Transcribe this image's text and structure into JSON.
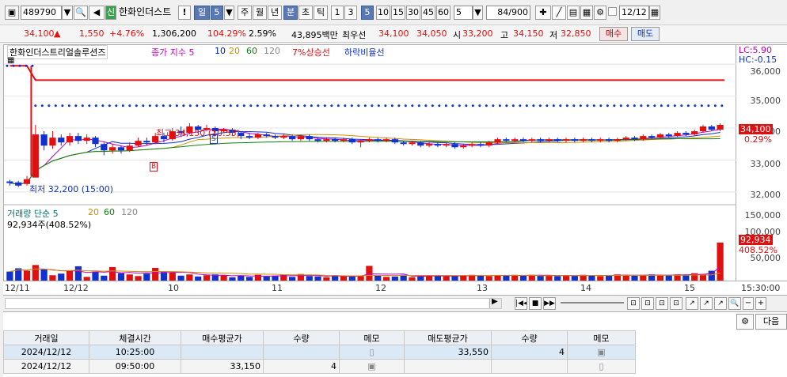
{
  "toolbar": {
    "code": "489790",
    "stock_badge": "신",
    "stock_name": "한화인더스트",
    "periods": [
      "일",
      "5",
      "주",
      "월",
      "년",
      "분",
      "초",
      "틱"
    ],
    "minutes": [
      "1",
      "3",
      "5",
      "10",
      "15",
      "30",
      "45",
      "60"
    ],
    "interval_value": "5",
    "count_display": "84/900",
    "date": "12/12"
  },
  "quote": {
    "price": "34,100",
    "arrow": "▲",
    "change": "1,550",
    "change_pct": "+4.76%",
    "volume": "1,306,200",
    "vol_ratio": "104.29%",
    "turnover": "2.59%",
    "amount": "43,895백만",
    "best_label": "최우선",
    "ask": "34,100",
    "bid": "34,050",
    "open_label": "시",
    "open": "33,200",
    "high_label": "고",
    "high": "34,150",
    "low_label": "저",
    "low": "32,850",
    "buy_btn": "매수",
    "sell_btn": "매도"
  },
  "chart": {
    "title": "한화인더스트리얼솔루션즈",
    "price_legend": "종가 지수 5",
    "ma_labels": [
      "10",
      "20",
      "60",
      "120"
    ],
    "ma_colors": [
      "#ff7700",
      "#c8a000",
      "#108010",
      "#a0a0a0"
    ],
    "upper_limit_label": "7%상승선",
    "lower_limit_label": "하락비율선",
    "lc_label": "LC:5.90",
    "hc_label": "HC:-0.15",
    "price_ticks": [
      "36,000",
      "35,000",
      "34,000",
      "33,000",
      "32,000"
    ],
    "current_price_tag": "34,100",
    "current_pct_tag": "0.29%",
    "high_annot": "최고 34,150 (10:55)",
    "low_annot": "최저 32,200 (15:00)",
    "marker_s": "S",
    "marker_b": "B",
    "volume_legend": "거래량 단순 5",
    "volume_ma": [
      "20",
      "60",
      "120"
    ],
    "volume_value": "92,934주(408.52%)",
    "volume_ticks": [
      "150,000",
      "100,000",
      "50,000"
    ],
    "volume_tag": "92,934",
    "volume_pct_tag": "408.52%",
    "time_labels": [
      "12/11",
      "12/12",
      "10",
      "11",
      "12",
      "13",
      "14",
      "15"
    ],
    "time_end": "15:30:00"
  },
  "chart_data": {
    "type": "candlestick",
    "ylim": [
      31700,
      36400
    ],
    "candles": [
      {
        "o": 32330,
        "c": 32280,
        "h": 32380,
        "l": 32200
      },
      {
        "o": 32300,
        "c": 32200,
        "h": 32350,
        "l": 32150
      },
      {
        "o": 32250,
        "c": 32400,
        "h": 32500,
        "l": 32200
      },
      {
        "o": 32450,
        "c": 33800,
        "h": 34100,
        "l": 32850
      },
      {
        "o": 33800,
        "c": 33450,
        "h": 33900,
        "l": 33300
      },
      {
        "o": 33450,
        "c": 33700,
        "h": 33900,
        "l": 33350
      },
      {
        "o": 33700,
        "c": 33550,
        "h": 33800,
        "l": 33450
      },
      {
        "o": 33550,
        "c": 33750,
        "h": 33850,
        "l": 33450
      },
      {
        "o": 33750,
        "c": 33600,
        "h": 33850,
        "l": 33500
      },
      {
        "o": 33600,
        "c": 33700,
        "h": 33800,
        "l": 33500
      },
      {
        "o": 33700,
        "c": 33500,
        "h": 33750,
        "l": 33400
      },
      {
        "o": 33500,
        "c": 33300,
        "h": 33550,
        "l": 33150
      },
      {
        "o": 33300,
        "c": 33400,
        "h": 33500,
        "l": 33200
      },
      {
        "o": 33400,
        "c": 33300,
        "h": 33450,
        "l": 33200
      },
      {
        "o": 33300,
        "c": 33450,
        "h": 33550,
        "l": 33250
      },
      {
        "o": 33450,
        "c": 33600,
        "h": 33700,
        "l": 33400
      },
      {
        "o": 33600,
        "c": 33550,
        "h": 33700,
        "l": 33450
      },
      {
        "o": 33550,
        "c": 33750,
        "h": 33850,
        "l": 33500
      },
      {
        "o": 33750,
        "c": 33650,
        "h": 33850,
        "l": 33550
      },
      {
        "o": 33650,
        "c": 33900,
        "h": 34000,
        "l": 33600
      },
      {
        "o": 33900,
        "c": 33850,
        "h": 34050,
        "l": 33750
      },
      {
        "o": 33850,
        "c": 34050,
        "h": 34150,
        "l": 33800
      },
      {
        "o": 34050,
        "c": 33950,
        "h": 34100,
        "l": 33850
      },
      {
        "o": 33950,
        "c": 34000,
        "h": 34100,
        "l": 33900
      },
      {
        "o": 34000,
        "c": 33900,
        "h": 34050,
        "l": 33850
      },
      {
        "o": 33900,
        "c": 33950,
        "h": 34000,
        "l": 33850
      },
      {
        "o": 33950,
        "c": 33850,
        "h": 34000,
        "l": 33750
      },
      {
        "o": 33850,
        "c": 33750,
        "h": 33900,
        "l": 33650
      },
      {
        "o": 33750,
        "c": 33700,
        "h": 33850,
        "l": 33650
      },
      {
        "o": 33700,
        "c": 33800,
        "h": 33850,
        "l": 33650
      },
      {
        "o": 33800,
        "c": 33750,
        "h": 33850,
        "l": 33700
      },
      {
        "o": 33750,
        "c": 33700,
        "h": 33800,
        "l": 33650
      },
      {
        "o": 33700,
        "c": 33750,
        "h": 33800,
        "l": 33650
      },
      {
        "o": 33750,
        "c": 33650,
        "h": 33800,
        "l": 33600
      },
      {
        "o": 33650,
        "c": 33750,
        "h": 33800,
        "l": 33600
      },
      {
        "o": 33750,
        "c": 33650,
        "h": 33800,
        "l": 33600
      },
      {
        "o": 33650,
        "c": 33600,
        "h": 33700,
        "l": 33550
      },
      {
        "o": 33600,
        "c": 33650,
        "h": 33700,
        "l": 33550
      },
      {
        "o": 33650,
        "c": 33600,
        "h": 33700,
        "l": 33550
      },
      {
        "o": 33600,
        "c": 33650,
        "h": 33700,
        "l": 33550
      },
      {
        "o": 33650,
        "c": 33550,
        "h": 33700,
        "l": 33500
      },
      {
        "o": 33550,
        "c": 33600,
        "h": 33650,
        "l": 33400
      },
      {
        "o": 33600,
        "c": 33650,
        "h": 33700,
        "l": 33550
      },
      {
        "o": 33650,
        "c": 33600,
        "h": 33700,
        "l": 33550
      },
      {
        "o": 33600,
        "c": 33650,
        "h": 33700,
        "l": 33550
      },
      {
        "o": 33650,
        "c": 33550,
        "h": 33700,
        "l": 33500
      },
      {
        "o": 33550,
        "c": 33500,
        "h": 33600,
        "l": 33450
      },
      {
        "o": 33500,
        "c": 33550,
        "h": 33600,
        "l": 33450
      },
      {
        "o": 33550,
        "c": 33450,
        "h": 33600,
        "l": 33400
      },
      {
        "o": 33450,
        "c": 33500,
        "h": 33550,
        "l": 33400
      },
      {
        "o": 33500,
        "c": 33450,
        "h": 33550,
        "l": 33400
      },
      {
        "o": 33450,
        "c": 33500,
        "h": 33550,
        "l": 33400
      },
      {
        "o": 33500,
        "c": 33400,
        "h": 33550,
        "l": 33350
      },
      {
        "o": 33400,
        "c": 33450,
        "h": 33500,
        "l": 33350
      },
      {
        "o": 33450,
        "c": 33500,
        "h": 33550,
        "l": 33400
      },
      {
        "o": 33500,
        "c": 33450,
        "h": 33550,
        "l": 33400
      },
      {
        "o": 33450,
        "c": 33550,
        "h": 33600,
        "l": 33400
      },
      {
        "o": 33550,
        "c": 33650,
        "h": 33700,
        "l": 33500
      },
      {
        "o": 33650,
        "c": 33600,
        "h": 33700,
        "l": 33550
      },
      {
        "o": 33600,
        "c": 33650,
        "h": 33700,
        "l": 33550
      },
      {
        "o": 33650,
        "c": 33600,
        "h": 33700,
        "l": 33550
      },
      {
        "o": 33600,
        "c": 33650,
        "h": 33700,
        "l": 33550
      },
      {
        "o": 33650,
        "c": 33600,
        "h": 33700,
        "l": 33550
      },
      {
        "o": 33600,
        "c": 33650,
        "h": 33700,
        "l": 33550
      },
      {
        "o": 33650,
        "c": 33600,
        "h": 33700,
        "l": 33550
      },
      {
        "o": 33600,
        "c": 33650,
        "h": 33700,
        "l": 33550
      },
      {
        "o": 33650,
        "c": 33600,
        "h": 33700,
        "l": 33550
      },
      {
        "o": 33600,
        "c": 33650,
        "h": 33700,
        "l": 33550
      },
      {
        "o": 33650,
        "c": 33600,
        "h": 33700,
        "l": 33550
      },
      {
        "o": 33600,
        "c": 33650,
        "h": 33700,
        "l": 33550
      },
      {
        "o": 33650,
        "c": 33600,
        "h": 33700,
        "l": 33550
      },
      {
        "o": 33600,
        "c": 33650,
        "h": 33700,
        "l": 33550
      },
      {
        "o": 33650,
        "c": 33700,
        "h": 33750,
        "l": 33600
      },
      {
        "o": 33700,
        "c": 33650,
        "h": 33750,
        "l": 33600
      },
      {
        "o": 33650,
        "c": 33750,
        "h": 33800,
        "l": 33600
      },
      {
        "o": 33750,
        "c": 33700,
        "h": 33800,
        "l": 33650
      },
      {
        "o": 33700,
        "c": 33800,
        "h": 33850,
        "l": 33650
      },
      {
        "o": 33800,
        "c": 33750,
        "h": 33850,
        "l": 33700
      },
      {
        "o": 33750,
        "c": 33850,
        "h": 33900,
        "l": 33700
      },
      {
        "o": 33850,
        "c": 33800,
        "h": 33900,
        "l": 33750
      },
      {
        "o": 33800,
        "c": 33900,
        "h": 33950,
        "l": 33750
      },
      {
        "o": 33900,
        "c": 34050,
        "h": 34100,
        "l": 33850
      },
      {
        "o": 34050,
        "c": 33950,
        "h": 34100,
        "l": 33900
      },
      {
        "o": 33950,
        "c": 34100,
        "h": 34150,
        "l": 33900
      }
    ],
    "volumes": [
      22000,
      30000,
      24000,
      38000,
      27000,
      13000,
      17000,
      25000,
      35000,
      9000,
      22000,
      12000,
      33000,
      18000,
      15000,
      11000,
      17000,
      31000,
      21000,
      20000,
      12000,
      15000,
      10000,
      13000,
      15000,
      13000,
      8000,
      12000,
      9000,
      14000,
      10000,
      12000,
      14000,
      9000,
      16000,
      11000,
      10000,
      8000,
      13000,
      12000,
      10000,
      11000,
      36000,
      12000,
      9000,
      10000,
      14000,
      8000,
      11000,
      13000,
      12000,
      10000,
      11000,
      12000,
      14000,
      13000,
      11000,
      13000,
      12000,
      14000,
      12000,
      14000,
      13000,
      12000,
      11000,
      13000,
      12000,
      14000,
      13000,
      11000,
      13000,
      15000,
      14000,
      12000,
      13000,
      15000,
      14000,
      13000,
      15000,
      14000,
      18000,
      16000,
      24000,
      92934
    ],
    "vol_ylim": [
      0,
      170000
    ],
    "upper_limit_line": 35500,
    "dotted_high": 34700,
    "dotted_start": 35950
  },
  "trades": {
    "headers": [
      "거래일",
      "체결시간",
      "매수평균가",
      "수량",
      "메모",
      "매도평균가",
      "수량",
      "메모"
    ],
    "rows": [
      [
        "2024/12/12",
        "10:25:00",
        "",
        "",
        "",
        "33,550",
        "4",
        ""
      ],
      [
        "2024/12/12",
        "09:50:00",
        "33,150",
        "4",
        "",
        "",
        "",
        ""
      ]
    ]
  },
  "bottom": {
    "next_btn": "다음"
  }
}
